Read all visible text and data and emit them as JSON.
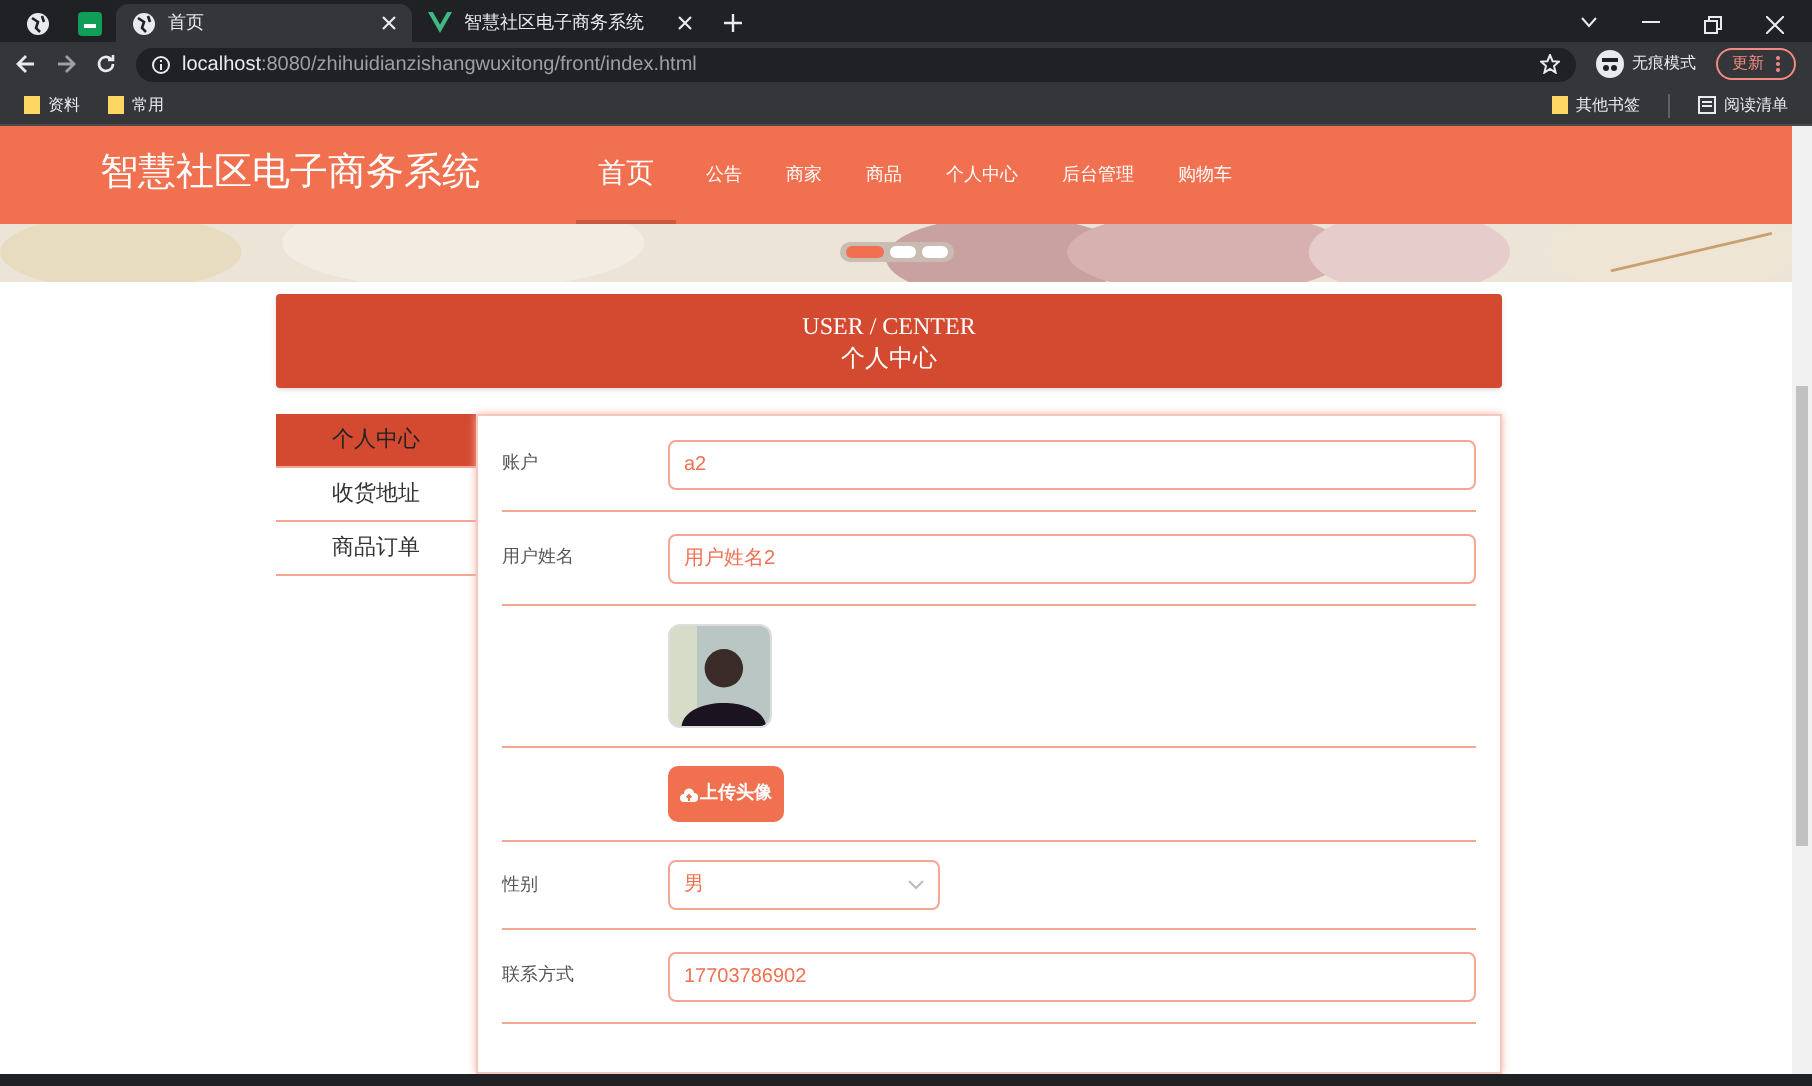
{
  "browser": {
    "tabs": [
      {
        "kind": "pinned",
        "selected": false
      },
      {
        "kind": "pinned",
        "selected": false
      },
      {
        "kind": "tab",
        "title": "首页",
        "selected": true
      },
      {
        "kind": "tab",
        "title": "智慧社区电子商务系统",
        "selected": false
      }
    ],
    "address": {
      "host": "localhost",
      "rest": ":8080/zhihuidianzishangwuxitong/front/index.html"
    },
    "incognito": "无痕模式",
    "update": "更新",
    "bookmarks": [
      "资料",
      "常用"
    ],
    "other_bookmarks": "其他书签",
    "reading_list": "阅读清单"
  },
  "header": {
    "brand": "智慧社区电子商务系统",
    "nav": [
      {
        "label": "首页",
        "selected": true
      },
      {
        "label": "公告",
        "selected": false
      },
      {
        "label": "商家",
        "selected": false
      },
      {
        "label": "商品",
        "selected": false
      },
      {
        "label": "个人中心",
        "selected": false
      },
      {
        "label": "后台管理",
        "selected": false
      },
      {
        "label": "购物车",
        "selected": false
      }
    ]
  },
  "carousel": {
    "dots": [
      {
        "selected": true
      },
      {
        "selected": false
      },
      {
        "selected": false
      }
    ]
  },
  "banner": {
    "title_en": "USER / CENTER",
    "title_zh": "个人中心"
  },
  "sidebar": {
    "items": [
      {
        "label": "个人中心",
        "selected": true
      },
      {
        "label": "收货地址",
        "selected": false
      },
      {
        "label": "商品订单",
        "selected": false
      }
    ]
  },
  "form": {
    "rows": [
      {
        "kind": "input",
        "label": "账户",
        "value": "a2"
      },
      {
        "kind": "input",
        "label": "用户姓名",
        "value": "用户姓名2"
      },
      {
        "kind": "avatar"
      },
      {
        "kind": "upload",
        "button": "上传头像"
      },
      {
        "kind": "select",
        "label": "性别",
        "value": "男"
      },
      {
        "kind": "input",
        "label": "联系方式",
        "value": "17703786902"
      }
    ]
  }
}
